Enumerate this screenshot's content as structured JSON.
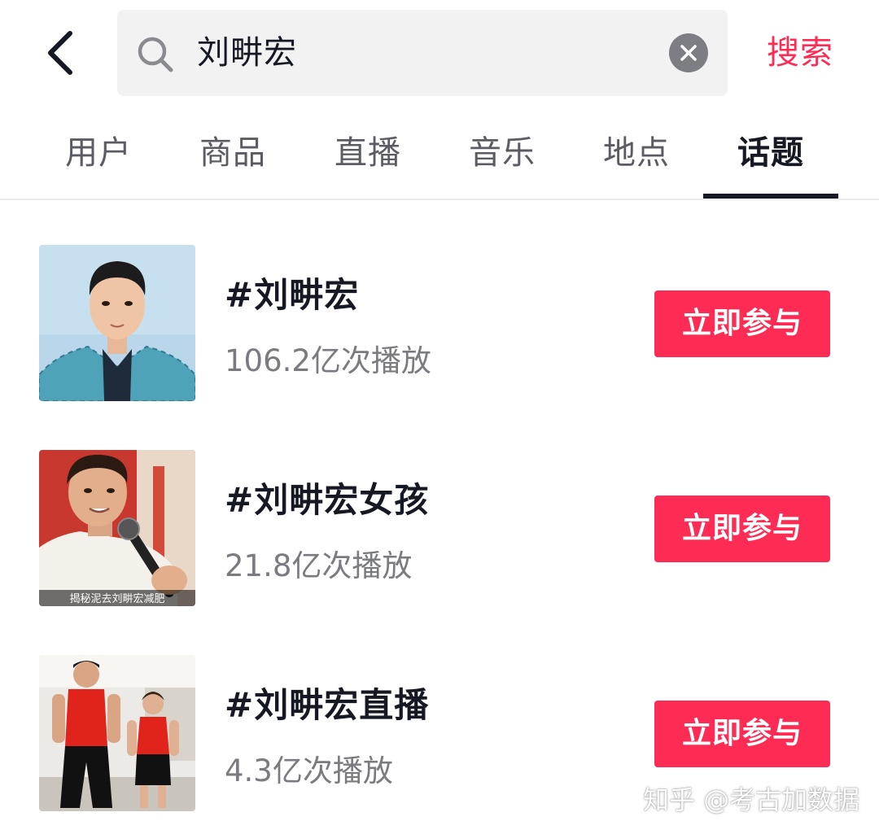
{
  "search": {
    "back_icon": "chevron-left-icon",
    "search_icon": "search-icon",
    "query": "刘畊宏",
    "clear_icon": "clear-icon",
    "submit_label": "搜索"
  },
  "tabs": [
    {
      "label": "用户",
      "active": false
    },
    {
      "label": "商品",
      "active": false
    },
    {
      "label": "直播",
      "active": false
    },
    {
      "label": "音乐",
      "active": false
    },
    {
      "label": "地点",
      "active": false
    },
    {
      "label": "话题",
      "active": true
    }
  ],
  "topics": [
    {
      "title": "#刘畊宏",
      "plays": "106.2亿次播放",
      "button": "立即参与"
    },
    {
      "title": "#刘畊宏女孩",
      "plays": "21.8亿次播放",
      "button": "立即参与",
      "thumb_caption": "揭秘泥去刘畊宏减肥"
    },
    {
      "title": "#刘畊宏直播",
      "plays": "4.3亿次播放",
      "button": "立即参与"
    }
  ],
  "watermark": "知乎 @考古加数据",
  "colors": {
    "accent": "#fe2c55",
    "text_primary": "#161823",
    "text_secondary": "#7a7b80"
  }
}
